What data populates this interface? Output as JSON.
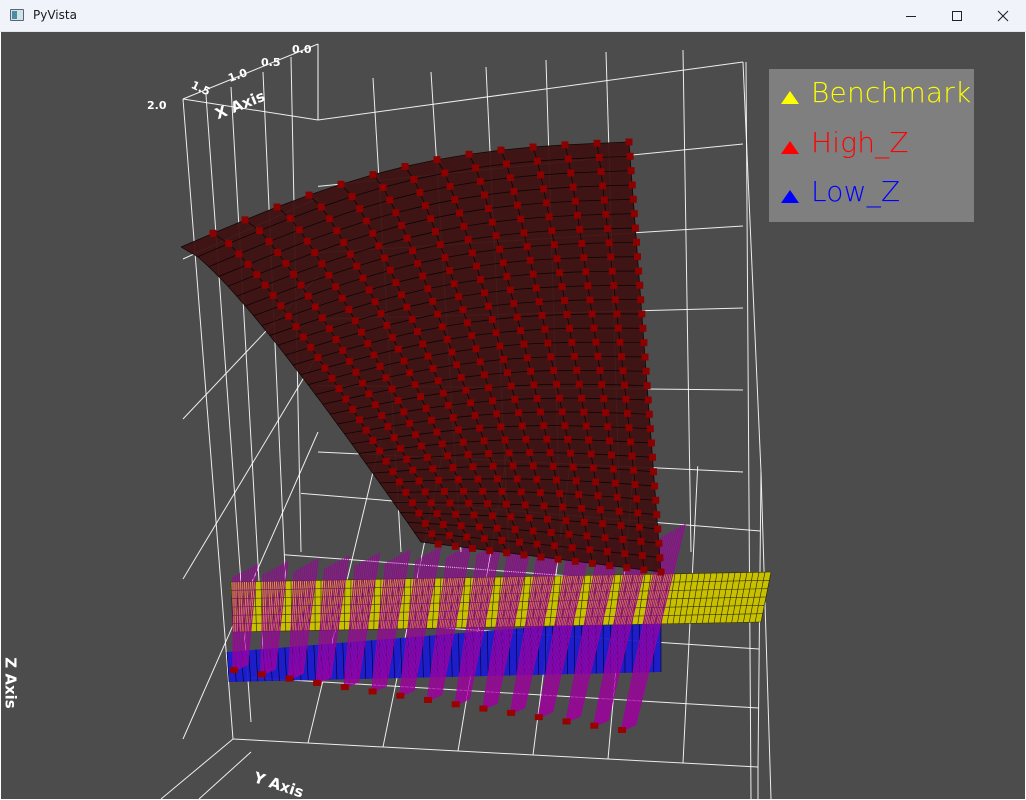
{
  "window": {
    "title": "PyVista",
    "icon": "pyvista-app-icon",
    "controls": [
      "minimize-icon",
      "maximize-icon",
      "close-icon"
    ]
  },
  "scene": {
    "background_color": "#4c4c4c",
    "axes": {
      "x_title": "X Axis",
      "y_title": "Y Axis",
      "z_title": "Z Axis",
      "x_ticks": [
        "0.0",
        "0.5",
        "1.0",
        "1.5",
        "2.0"
      ]
    },
    "legend": {
      "background_color": "#7f7f7f",
      "entries": [
        {
          "label": "Benchmark",
          "color": "#ffff00",
          "glyph": "triangle-icon"
        },
        {
          "label": "High_Z",
          "color": "#ff0000",
          "glyph": "triangle-icon"
        },
        {
          "label": "Low_Z",
          "color": "#0000ff",
          "glyph": "triangle-icon"
        }
      ]
    },
    "surfaces": {
      "high_z_fill": "#3d1212",
      "high_z_markers": "#8b0000",
      "benchmark_color": "#c8c000",
      "low_z_color": "#1a1ad0",
      "error_bars": "#a000a0"
    }
  }
}
